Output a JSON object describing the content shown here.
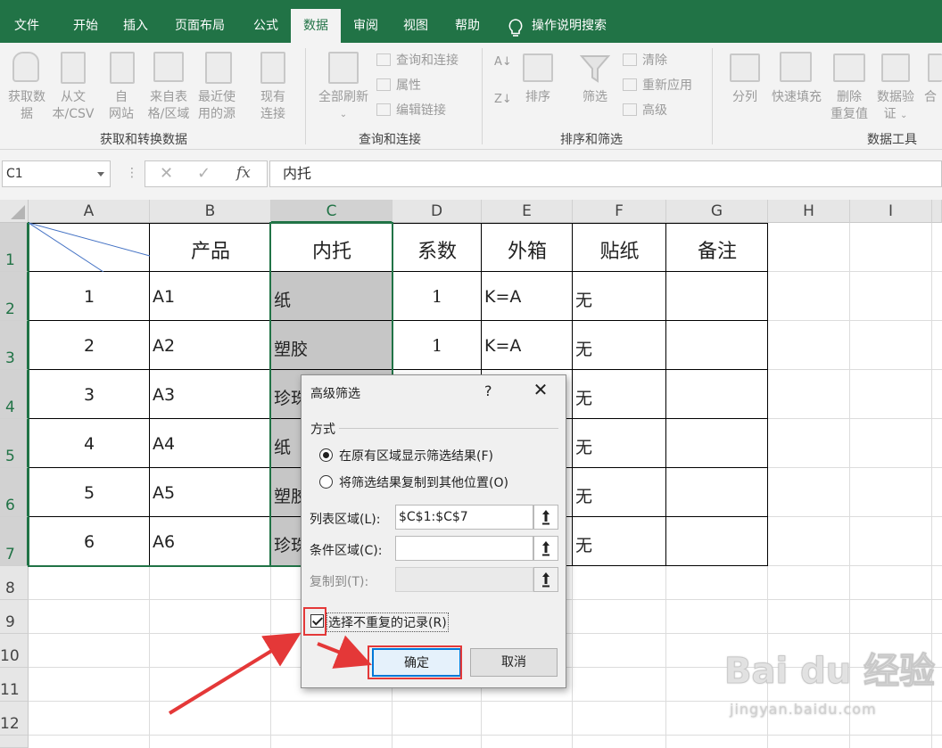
{
  "tabs": [
    "文件",
    "开始",
    "插入",
    "页面布局",
    "公式",
    "数据",
    "审阅",
    "视图",
    "帮助"
  ],
  "tell_me": "操作说明搜索",
  "ribbon": {
    "get_data": [
      "获取数",
      "据"
    ],
    "from_text": [
      "从文",
      "本/CSV"
    ],
    "from_web": [
      "自",
      "网站"
    ],
    "from_table": [
      "来自表",
      "格/区域"
    ],
    "recent_sources": [
      "最近使",
      "用的源"
    ],
    "existing_conn": [
      "现有",
      "连接"
    ],
    "group_get": "获取和转换数据",
    "refresh_all": "全部刷新",
    "queries_conn": "查询和连接",
    "properties": "属性",
    "edit_links": "编辑链接",
    "group_query": "查询和连接",
    "sort": "排序",
    "filter": "筛选",
    "clear": "清除",
    "reapply": "重新应用",
    "advanced": "高级",
    "group_sort": "排序和筛选",
    "text_to_col": "分列",
    "flash_fill": "快速填充",
    "remove_dup": [
      "删除",
      "重复值"
    ],
    "data_validation": [
      "数据验",
      "证"
    ],
    "consolidate": "合",
    "group_tools": "数据工具"
  },
  "formula_bar": {
    "name_box": "C1",
    "content": "内托"
  },
  "columns": [
    "A",
    "B",
    "C",
    "D",
    "E",
    "F",
    "G",
    "H",
    "I"
  ],
  "rows": [
    "1",
    "2",
    "3",
    "4",
    "5",
    "6",
    "7",
    "8",
    "9",
    "10",
    "11",
    "12"
  ],
  "table": {
    "headers": [
      "",
      "产品",
      "内托",
      "系数",
      "外箱",
      "贴纸",
      "备注"
    ],
    "data": [
      [
        "1",
        "A1",
        "纸",
        "1",
        "K=A",
        "无",
        ""
      ],
      [
        "2",
        "A2",
        "塑胶",
        "1",
        "K=A",
        "无",
        ""
      ],
      [
        "3",
        "A3",
        "珍珠",
        "",
        "",
        "无",
        ""
      ],
      [
        "4",
        "A4",
        "纸",
        "",
        "",
        "无",
        ""
      ],
      [
        "5",
        "A5",
        "塑胶",
        "",
        "",
        "无",
        ""
      ],
      [
        "6",
        "A6",
        "珍珠",
        "",
        "",
        "无",
        ""
      ]
    ]
  },
  "dialog": {
    "title": "高级筛选",
    "help": "?",
    "close": "✕",
    "method": "方式",
    "option_in_place": "在原有区域显示筛选结果(F)",
    "option_copy": "将筛选结果复制到其他位置(O)",
    "list_range_label": "列表区域(L):",
    "list_range_value": "$C$1:$C$7",
    "criteria_label": "条件区域(C):",
    "criteria_value": "",
    "copy_to_label": "复制到(T):",
    "copy_to_value": "",
    "unique_label": "选择不重复的记录(R)",
    "ok": "确定",
    "cancel": "取消"
  },
  "watermark": {
    "logo": "Bai du 经验",
    "url": "jingyan.baidu.com"
  },
  "colors": {
    "excel_green": "#217346",
    "annotation_red": "#e43838",
    "selection_gray": "#c6c6c6"
  }
}
